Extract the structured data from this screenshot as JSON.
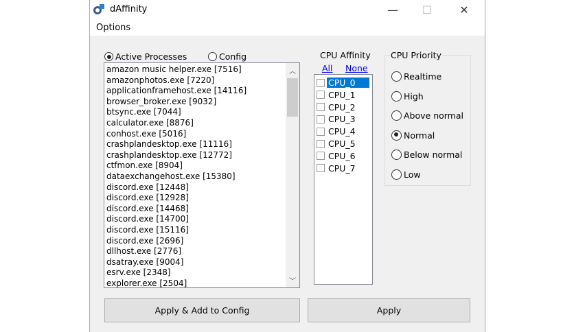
{
  "window": {
    "title": "dAffinity",
    "minimize": "—",
    "maximize": "☐",
    "close": "✕"
  },
  "menu": {
    "options": "Options"
  },
  "source": {
    "active": "Active Processes",
    "config": "Config",
    "selected": "active"
  },
  "processes": [
    "amazon music helper.exe  [7516]",
    "amazonphotos.exe  [7220]",
    "applicationframehost.exe  [14116]",
    "browser_broker.exe  [9032]",
    "btsync.exe  [7044]",
    "calculator.exe  [8876]",
    "conhost.exe  [5016]",
    "crashplandesktop.exe  [11116]",
    "crashplandesktop.exe  [12772]",
    "ctfmon.exe  [8904]",
    "dataexchangehost.exe  [15380]",
    "discord.exe  [12448]",
    "discord.exe  [12928]",
    "discord.exe  [14468]",
    "discord.exe  [14700]",
    "discord.exe  [15116]",
    "discord.exe  [2696]",
    "dllhost.exe  [2776]",
    "dsatray.exe  [9004]",
    "esrv.exe  [2348]",
    "explorer.exe  [2504]"
  ],
  "affinity": {
    "label": "CPU Affinity",
    "all": "All",
    "none": "None",
    "cpus": [
      "CPU_0",
      "CPU_1",
      "CPU_2",
      "CPU_3",
      "CPU_4",
      "CPU_5",
      "CPU_6",
      "CPU_7"
    ],
    "selected": "CPU_0"
  },
  "priority": {
    "label": "CPU Priority",
    "options": [
      "Realtime",
      "High",
      "Above normal",
      "Normal",
      "Below normal",
      "Low"
    ],
    "selected": "Normal"
  },
  "buttons": {
    "apply_add": "Apply & Add to Config",
    "apply": "Apply"
  }
}
